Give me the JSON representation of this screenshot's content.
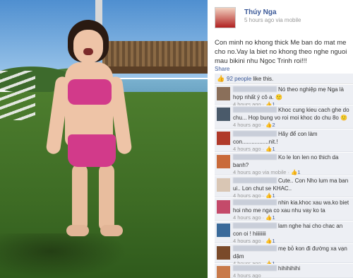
{
  "post": {
    "author": "Thúy Nga",
    "time": "5 hours ago via mobile",
    "text": "Con minh no khong thick Me ban do mat me cho no.Vay la biet no khong theo nghe nguoi mau bikini nhu Ngoc Trinh roi!!!",
    "share": "Share",
    "likes_count": "92 people",
    "likes_suffix": " like this."
  },
  "comments": [
    {
      "text": "Nó theo nghiệp mẹ Nga là hợp nhất ý cô a. 🙂",
      "time": "4 hours ago",
      "likes": "1",
      "avatar_color": "#8a6f5a"
    },
    {
      "text": "Khoc cung kieu cach ghe do chu... Hop bung vo roi moi khoc do chu 8o 🙂",
      "time": "4 hours ago",
      "likes": "2",
      "avatar_color": "#4a5a6a"
    },
    {
      "text": "Hãy để con làm con.................nit.!",
      "time": "4 hours ago",
      "likes": "1",
      "avatar_color": "#b03a2a"
    },
    {
      "text": "Ko le lon len no thich da banh?",
      "time": "4 hours ago via mobile",
      "likes": "1",
      "avatar_color": "#c96a3a"
    },
    {
      "text": "Cute.. Con Nho lum ma ban ui.. Lon chut se KHAC..",
      "time": "4 hours ago",
      "likes": "1",
      "avatar_color": "#d9c6b4"
    },
    {
      "text": "nhin kia.khoc xau wa.ko biet hoi nho me nga co xau nhu vay ko ta",
      "time": "4 hours ago",
      "likes": "1",
      "avatar_color": "#c44a6a"
    },
    {
      "text": "lam nghe hai cho chac an con oi ! hiiiiiiii",
      "time": "4 hours ago",
      "likes": "1",
      "avatar_color": "#3a6a9a"
    },
    {
      "text": "mẹ bỏ kon đi đường xa vạn dặm",
      "time": "4 hours ago",
      "likes": "1",
      "avatar_color": "#7a4a2a"
    },
    {
      "text": "hihihihihi",
      "time": "4 hours ago",
      "likes": "",
      "avatar_color": "#c87a4a"
    }
  ]
}
